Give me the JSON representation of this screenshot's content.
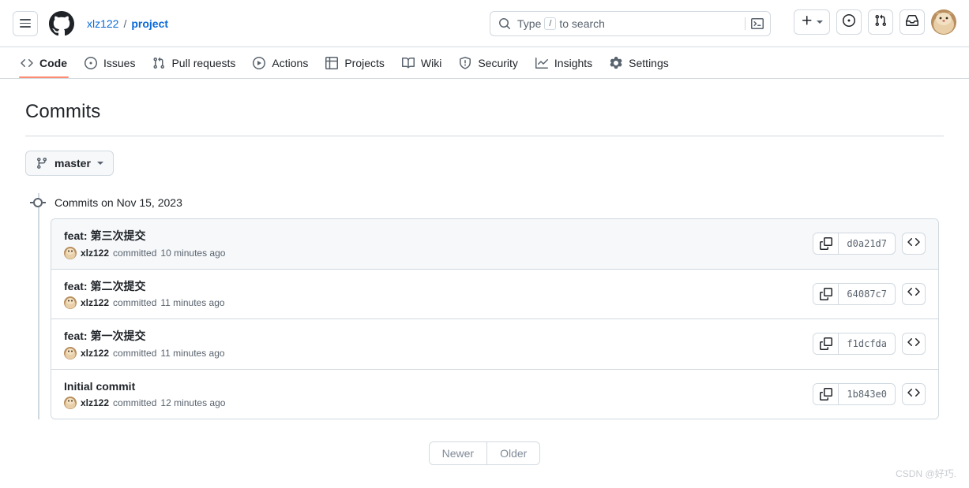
{
  "header": {
    "menu_icon": "hamburger-icon",
    "logo_icon": "github-logo-icon",
    "owner": "xlz122",
    "separator": "/",
    "repo": "project",
    "search": {
      "icon": "search-icon",
      "placeholder_prefix": "Type",
      "slash_key": "/",
      "placeholder_suffix": "to search",
      "terminal_icon": "terminal-icon"
    },
    "actions": [
      {
        "name": "create-new-button",
        "icon": "plus-icon",
        "has_caret": true
      },
      {
        "name": "issues-button",
        "icon": "issue-opened-icon"
      },
      {
        "name": "pull-requests-button",
        "icon": "git-pull-request-icon"
      },
      {
        "name": "notifications-button",
        "icon": "inbox-icon"
      },
      {
        "name": "user-avatar",
        "icon": "avatar-icon"
      }
    ]
  },
  "repo_nav": {
    "items": [
      {
        "label": "Code",
        "icon": "code-icon",
        "selected": true
      },
      {
        "label": "Issues",
        "icon": "issue-opened-icon",
        "selected": false
      },
      {
        "label": "Pull requests",
        "icon": "git-pull-request-icon",
        "selected": false
      },
      {
        "label": "Actions",
        "icon": "play-icon",
        "selected": false
      },
      {
        "label": "Projects",
        "icon": "table-icon",
        "selected": false
      },
      {
        "label": "Wiki",
        "icon": "book-icon",
        "selected": false
      },
      {
        "label": "Security",
        "icon": "shield-icon",
        "selected": false
      },
      {
        "label": "Insights",
        "icon": "graph-icon",
        "selected": false
      },
      {
        "label": "Settings",
        "icon": "gear-icon",
        "selected": false
      }
    ]
  },
  "main": {
    "title": "Commits",
    "branch_selector": {
      "label": "master",
      "icon": "git-branch-icon",
      "caret_icon": "chevron-down-icon"
    },
    "commit_group": {
      "header": "Commits on Nov 15, 2023",
      "dot_icon": "timeline-dot-icon",
      "commits": [
        {
          "message": "feat: 第三次提交",
          "author": "xlz122",
          "committed_text": "committed",
          "relative_time": "10 minutes ago",
          "sha": "d0a21d7",
          "copy_icon": "copy-icon",
          "browse_icon": "code-icon",
          "hovered": true
        },
        {
          "message": "feat: 第二次提交",
          "author": "xlz122",
          "committed_text": "committed",
          "relative_time": "11 minutes ago",
          "sha": "64087c7",
          "copy_icon": "copy-icon",
          "browse_icon": "code-icon",
          "hovered": false
        },
        {
          "message": "feat: 第一次提交",
          "author": "xlz122",
          "committed_text": "committed",
          "relative_time": "11 minutes ago",
          "sha": "f1dcfda",
          "copy_icon": "copy-icon",
          "browse_icon": "code-icon",
          "hovered": false
        },
        {
          "message": "Initial commit",
          "author": "xlz122",
          "committed_text": "committed",
          "relative_time": "12 minutes ago",
          "sha": "1b843e0",
          "copy_icon": "copy-icon",
          "browse_icon": "code-icon",
          "hovered": false
        }
      ]
    },
    "pagination": {
      "newer_label": "Newer",
      "older_label": "Older"
    }
  },
  "watermark": "CSDN @好巧.",
  "colors": {
    "link": "#0969da",
    "border": "#d1d9e0",
    "muted": "#59636e",
    "selected_underline": "#fd8c73",
    "row_hover": "#f6f8fa"
  }
}
